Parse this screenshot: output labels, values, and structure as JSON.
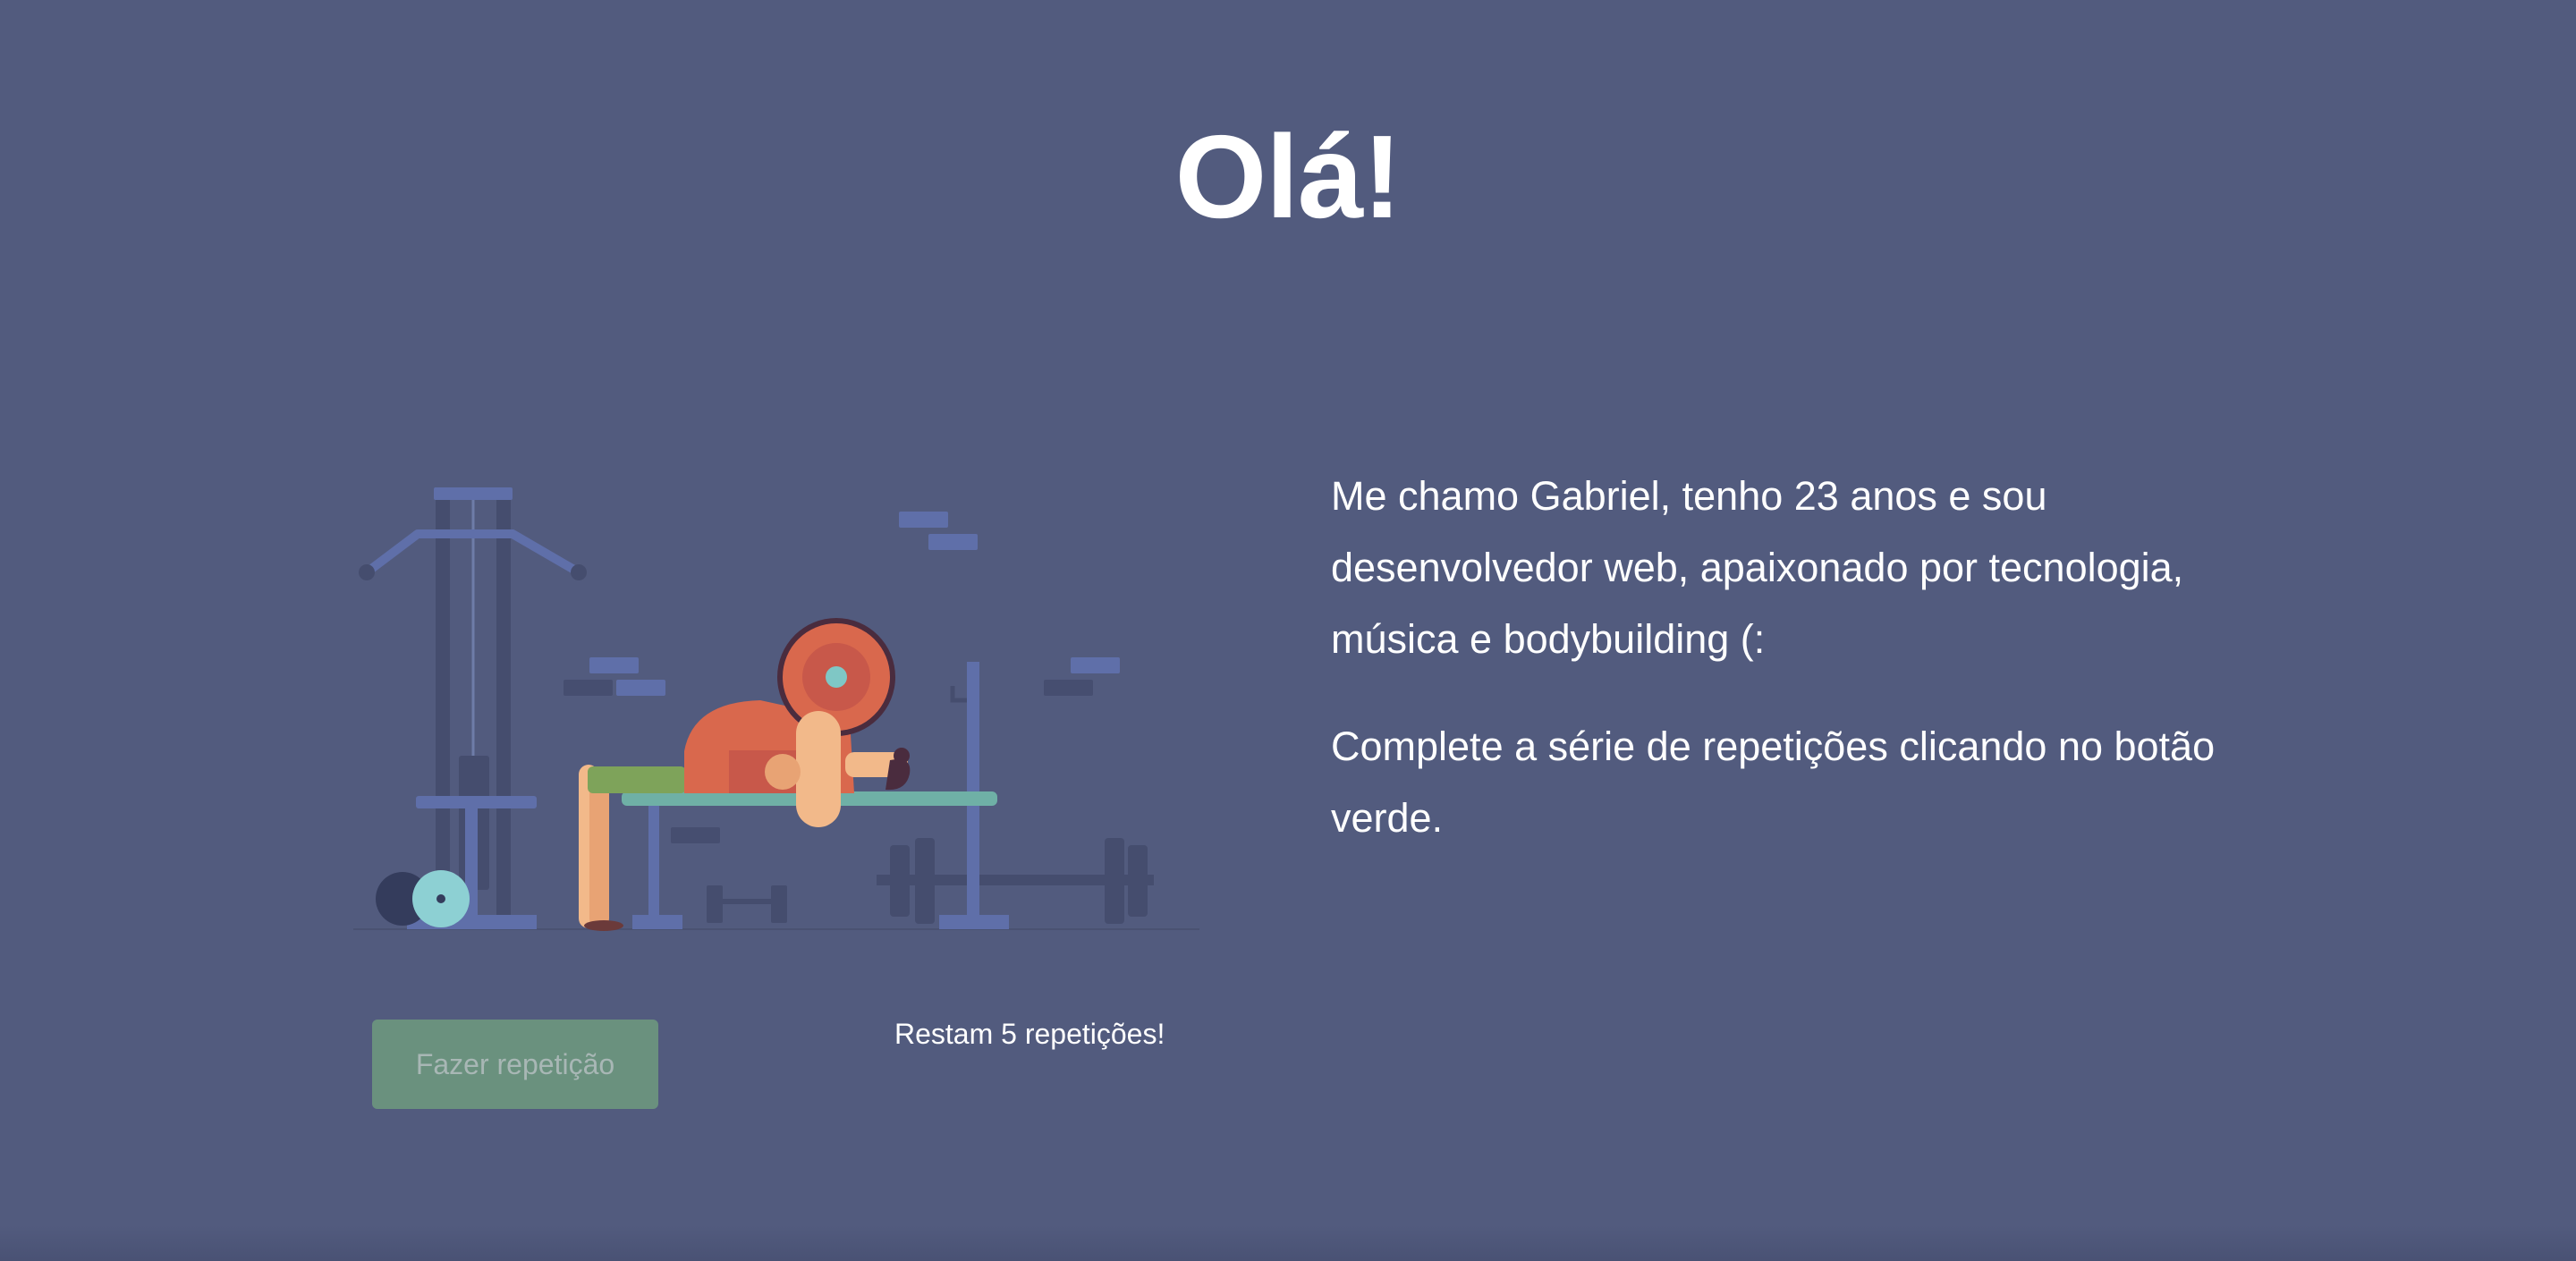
{
  "heading": "Olá!",
  "intro_text": "Me chamo Gabriel, tenho 23 anos e sou desenvolvedor web, apaixonado por tecnologia, música e bodybuilding (:",
  "instructions_text": "Complete a série de repetições clicando no botão verde.",
  "repetition_button": {
    "label": "Fazer repetição",
    "state": "disabled"
  },
  "counter_text": "Restam 5 repetições!",
  "illustration": {
    "icon": "bench-press-illustration"
  },
  "colors": {
    "background": "#525b7e",
    "button": "#6a917e",
    "button_text": "#a8b7b5",
    "text": "#ffffff"
  }
}
